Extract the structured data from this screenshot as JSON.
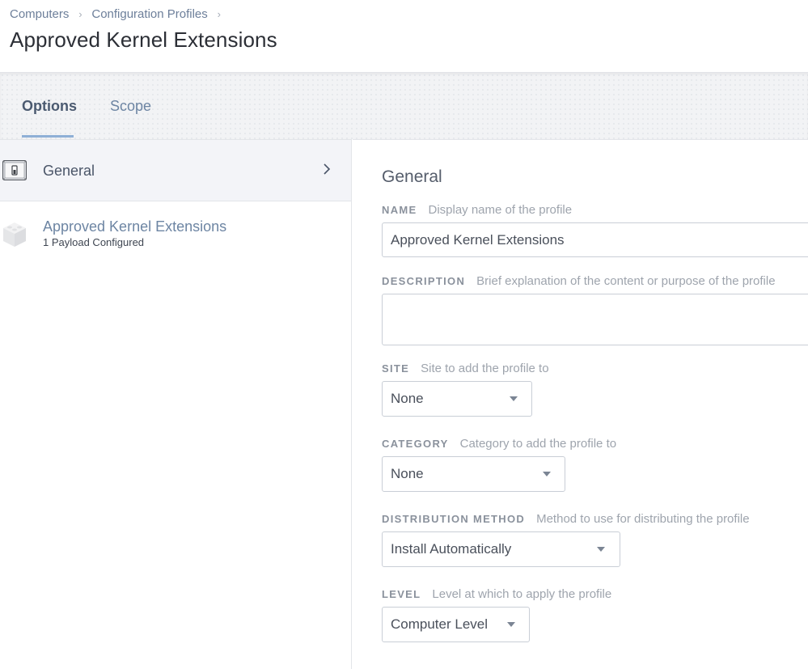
{
  "breadcrumb": {
    "items": [
      "Computers",
      "Configuration Profiles"
    ],
    "separator": "›"
  },
  "page_title": "Approved Kernel Extensions",
  "tabs": [
    {
      "label": "Options",
      "active": true
    },
    {
      "label": "Scope",
      "active": false
    }
  ],
  "sidebar": {
    "items": [
      {
        "label": "General",
        "icon": "switch-icon",
        "selected": true
      },
      {
        "label": "Approved Kernel Extensions",
        "sublabel": "1 Payload Configured",
        "icon": "cube-icon"
      }
    ]
  },
  "form": {
    "section_title": "General",
    "name": {
      "label": "NAME",
      "hint": "Display name of the profile",
      "value": "Approved Kernel Extensions"
    },
    "description": {
      "label": "DESCRIPTION",
      "hint": "Brief explanation of the content or purpose of the profile",
      "value": ""
    },
    "site": {
      "label": "SITE",
      "hint": "Site to add the profile to",
      "value": "None"
    },
    "category": {
      "label": "CATEGORY",
      "hint": "Category to add the profile to",
      "value": "None"
    },
    "distribution_method": {
      "label": "DISTRIBUTION METHOD",
      "hint": "Method to use for distributing the profile",
      "value": "Install Automatically"
    },
    "level": {
      "label": "LEVEL",
      "hint": "Level at which to apply the profile",
      "value": "Computer Level"
    }
  },
  "colors": {
    "link": "#6d7f9a",
    "tab_active_underline": "#8fb0d6",
    "selected_row": "#f3f4f8",
    "input_border": "#c9ced6"
  }
}
